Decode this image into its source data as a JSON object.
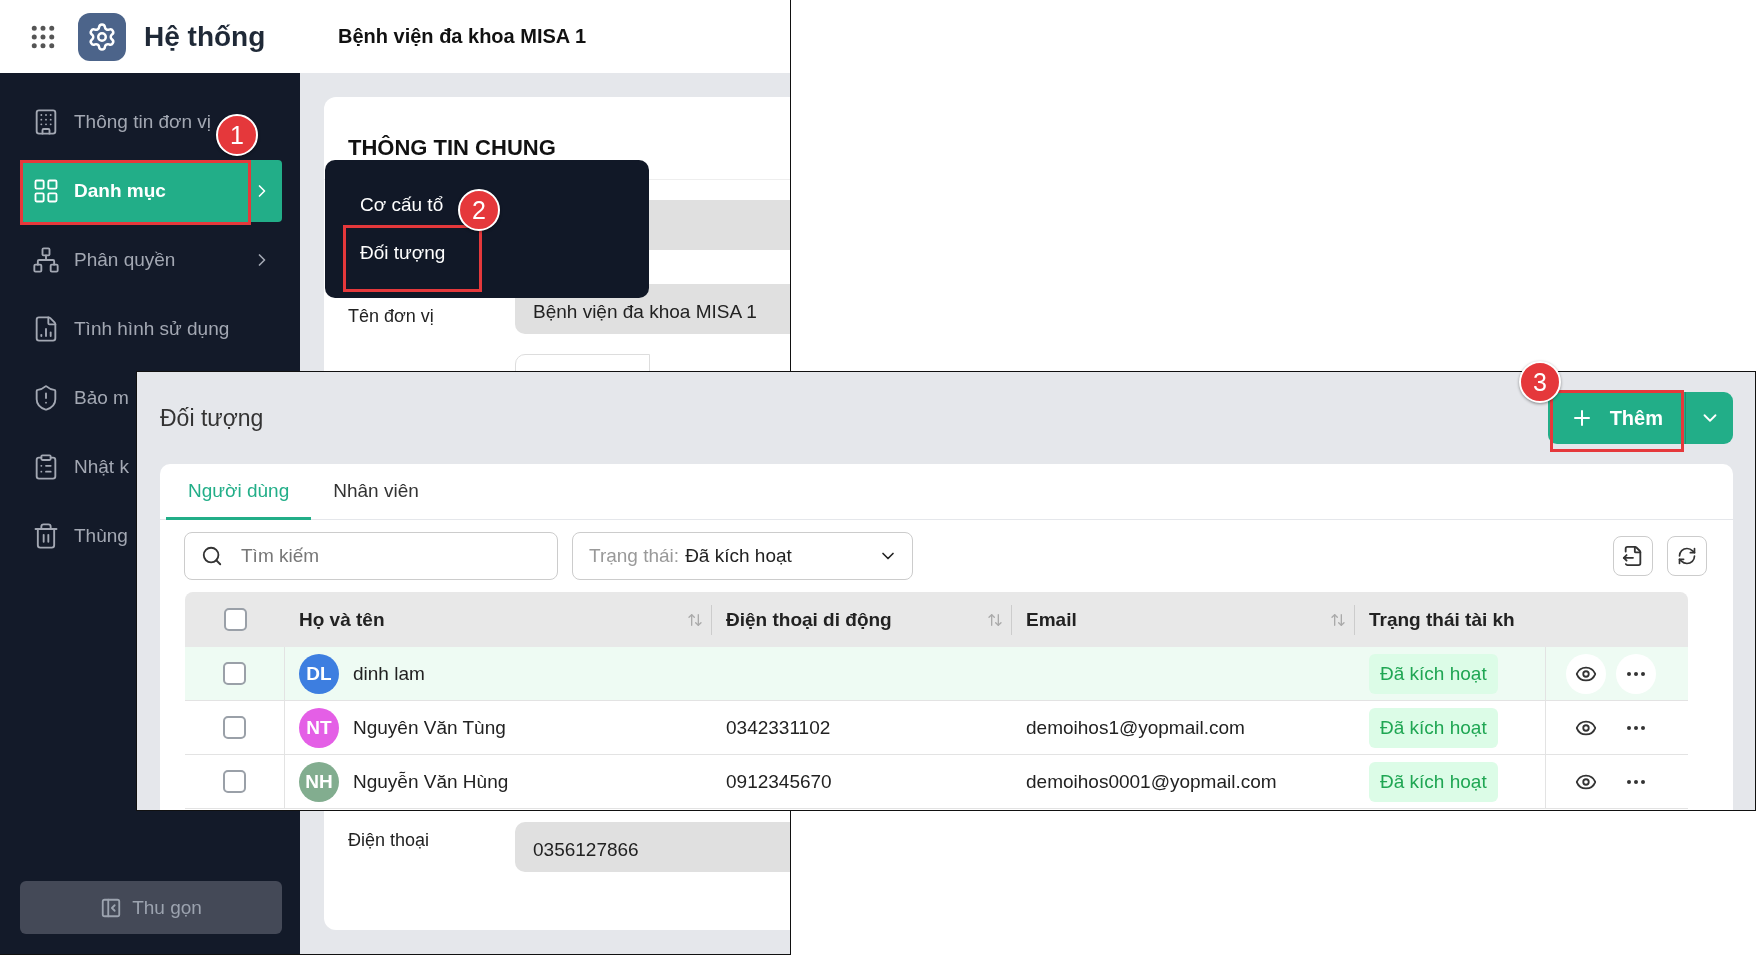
{
  "back_window": {
    "app_title": "Hệ thống",
    "org_name": "Bệnh viện đa khoa MISA 1",
    "sidebar": {
      "items": [
        {
          "label": "Thông tin đơn vị",
          "selected": false,
          "has_submenu": false
        },
        {
          "label": "Danh mục",
          "selected": true,
          "has_submenu": true
        },
        {
          "label": "Phân quyền",
          "selected": false,
          "has_submenu": true
        },
        {
          "label": "Tình hình sử dụng",
          "selected": false,
          "has_submenu": false
        },
        {
          "label": "Bảo m",
          "selected": false
        },
        {
          "label": "Nhật k",
          "selected": false
        },
        {
          "label": "Thùng",
          "selected": false
        }
      ],
      "collapse_button": "Thu gọn"
    },
    "section_title": "THÔNG TIN CHUNG",
    "fields": [
      {
        "label": "Tên đơn vị",
        "value": "Bệnh viện đa khoa MISA 1"
      },
      {
        "label": "Điện thoại",
        "value": "0356127866"
      }
    ],
    "submenu": {
      "items": [
        "Cơ cấu tổ",
        "Đối tượng"
      ]
    }
  },
  "front_window": {
    "title": "Đối tượng",
    "add_button": "Thêm",
    "tabs": [
      {
        "label": "Người dùng",
        "selected": true
      },
      {
        "label": "Nhân viên",
        "selected": false
      }
    ],
    "search": {
      "placeholder": "Tìm kiếm"
    },
    "status_filter": {
      "label": "Trạng thái:",
      "value": "Đã kích hoạt"
    },
    "table": {
      "select_all_checked": false,
      "columns": [
        "Họ và tên",
        "Điện thoại di động",
        "Email",
        "Trạng thái tài kh"
      ],
      "rows": [
        {
          "initials": "DL",
          "color": "#3d7ee0",
          "name": "dinh lam",
          "status": "Đã kích hoạt",
          "checked": false,
          "hovered": true
        },
        {
          "initials": "NT",
          "color": "#e45fe6",
          "name": "Nguyên Văn Tùng",
          "phone": "0342331102",
          "email": "demoihos1@yopmail.com",
          "status": "Đã kích hoạt",
          "checked": false,
          "hovered": false
        },
        {
          "initials": "NH",
          "color": "#82ad8f",
          "name": "Nguyễn Văn Hùng",
          "phone": "0912345670",
          "email": "demoihos0001@yopmail.com",
          "status": "Đã kích hoạt",
          "checked": false,
          "hovered": false
        }
      ]
    }
  },
  "annotations": [
    {
      "label": "1"
    },
    {
      "label": "2"
    },
    {
      "label": "3"
    }
  ]
}
